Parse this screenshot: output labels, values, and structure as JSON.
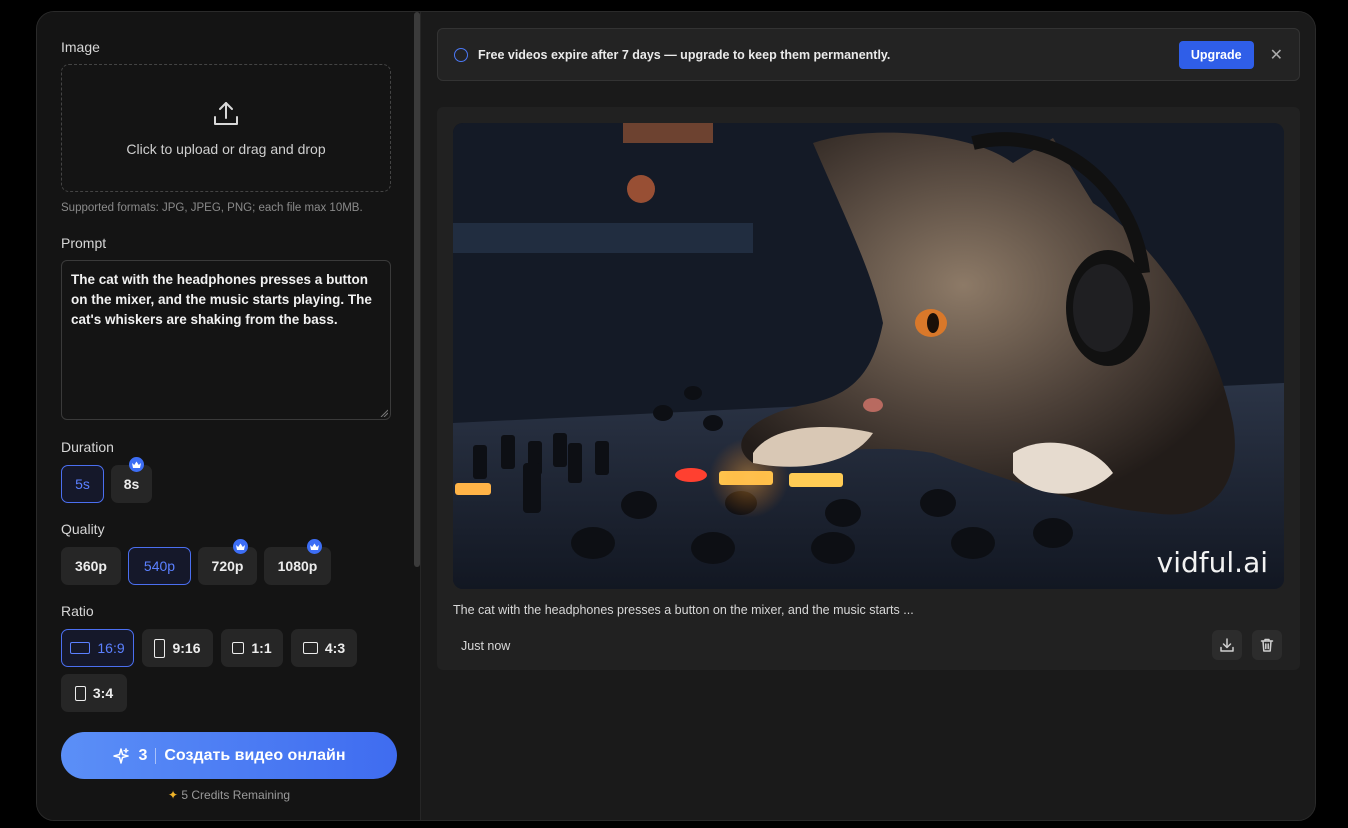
{
  "left_panel": {
    "image_label": "Image",
    "upload_text": "Click to upload or drag and drop",
    "formats_hint": "Supported formats: JPG, JPEG, PNG; each file max 10MB.",
    "prompt_label": "Prompt",
    "prompt_value": "The cat with the headphones presses a button on the mixer, and the music starts playing. The cat's whiskers are shaking from the bass.",
    "duration_label": "Duration",
    "durations": [
      {
        "label": "5s",
        "active": true,
        "premium": false
      },
      {
        "label": "8s",
        "active": false,
        "premium": true
      }
    ],
    "quality_label": "Quality",
    "qualities": [
      {
        "label": "360p",
        "active": false,
        "premium": false
      },
      {
        "label": "540p",
        "active": true,
        "premium": false
      },
      {
        "label": "720p",
        "active": false,
        "premium": true
      },
      {
        "label": "1080p",
        "active": false,
        "premium": true
      }
    ],
    "ratio_label": "Ratio",
    "ratios": [
      {
        "label": "16:9",
        "active": true
      },
      {
        "label": "9:16",
        "active": false
      },
      {
        "label": "1:1",
        "active": false
      },
      {
        "label": "4:3",
        "active": false
      },
      {
        "label": "3:4",
        "active": false
      }
    ],
    "generate_cost": "3",
    "generate_label": "Создать видео онлайн",
    "credits_text": "5 Credits Remaining"
  },
  "banner": {
    "message": "Free videos expire after 7 days — upgrade to keep them permanently.",
    "upgrade_label": "Upgrade",
    "close_icon": "close-icon"
  },
  "result": {
    "watermark": "vidful.ai",
    "caption": "The cat with the headphones presses a button on the mixer, and the music starts ...",
    "time": "Just now",
    "download_icon": "download-icon",
    "delete_icon": "trash-icon"
  },
  "colors": {
    "accent": "#3f6cf0",
    "crown": "#3d6ef5",
    "spark": "#f0b429"
  }
}
